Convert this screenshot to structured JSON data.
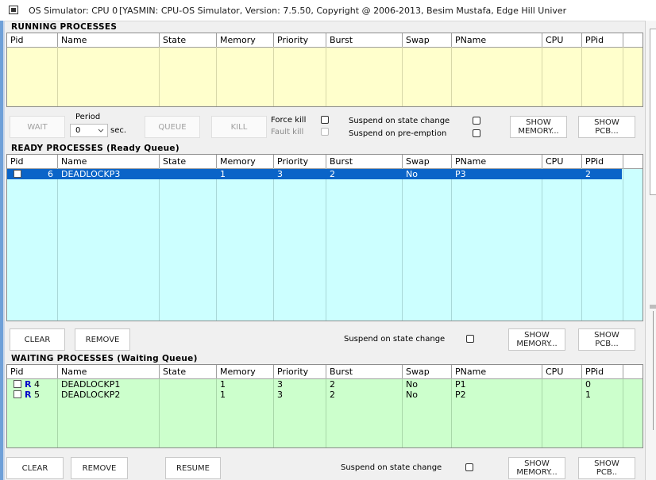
{
  "window": {
    "title_prefix": "OS Simulator: CPU 0",
    "title_rest": "[YASMIN: CPU-OS Simulator,  Version: 7.5.50,  Copyright @ 2006-2013, Besim Mustafa, Edge Hill Univer"
  },
  "columns": [
    "Pid",
    "Name",
    "State",
    "Memory",
    "Priority",
    "Burst",
    "Swap",
    "PName",
    "CPU",
    "PPid"
  ],
  "running": {
    "title": "RUNNING PROCESSES",
    "rows": []
  },
  "running_controls": {
    "wait_label": "WAIT",
    "period_label": "Period",
    "period_value": "0",
    "sec_label": "sec.",
    "queue_label": "QUEUE",
    "kill_label": "KILL",
    "force_kill_label": "Force kill",
    "fault_kill_label": "Fault kill",
    "suspend_change_label": "Suspend on state change",
    "suspend_preempt_label": "Suspend on pre-emption",
    "show_memory_label_1": "SHOW",
    "show_memory_label_2": "MEMORY...",
    "show_pcb_label_1": "SHOW",
    "show_pcb_label_2": "PCB..."
  },
  "ready": {
    "title": "READY PROCESSES (Ready Queue)",
    "rows": [
      {
        "pid": "6",
        "name": "DEADLOCKP3",
        "state": "",
        "memory": "1",
        "priority": "3",
        "burst": "2",
        "swap": "No",
        "pname": "P3",
        "cpu": "",
        "ppid": "2"
      }
    ]
  },
  "ready_controls": {
    "clear_label": "CLEAR",
    "remove_label": "REMOVE",
    "suspend_change_label": "Suspend on state change",
    "show_memory_label_1": "SHOW",
    "show_memory_label_2": "MEMORY...",
    "show_pcb_label_1": "SHOW",
    "show_pcb_label_2": "PCB..."
  },
  "waiting": {
    "title": "WAITING PROCESSES (Waiting Queue)",
    "rows": [
      {
        "mark": "R",
        "pid": "4",
        "name": "DEADLOCKP1",
        "state": "",
        "memory": "1",
        "priority": "3",
        "burst": "2",
        "swap": "No",
        "pname": "P1",
        "cpu": "",
        "ppid": "0"
      },
      {
        "mark": "R",
        "pid": "5",
        "name": "DEADLOCKP2",
        "state": "",
        "memory": "1",
        "priority": "3",
        "burst": "2",
        "swap": "No",
        "pname": "P2",
        "cpu": "",
        "ppid": "1"
      }
    ]
  },
  "waiting_controls": {
    "clear_label": "CLEAR",
    "remove_label": "REMOVE",
    "resume_label": "RESUME",
    "suspend_change_label": "Suspend on state change",
    "show_memory_label_1": "SHOW",
    "show_memory_label_2": "MEMORY...",
    "show_pcb_label_1": "SHOW",
    "show_pcb_label_2": "PCB.."
  },
  "colors": {
    "running_bg": "#ffffcc",
    "ready_bg": "#ccffff",
    "waiting_bg": "#ccffcc",
    "selected_row": "#0a64c8",
    "r_mark": "#0000c8"
  },
  "icons": {
    "window_icon": "cpu-window-icon",
    "dropdown": "chevron-down-icon"
  }
}
